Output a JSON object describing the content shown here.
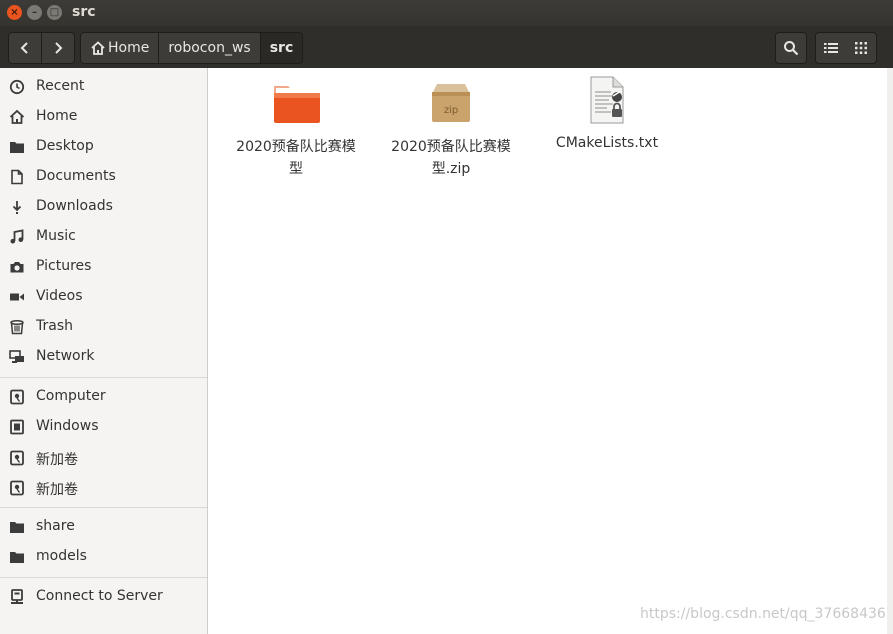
{
  "window": {
    "title": "src"
  },
  "titlebar": {
    "close_glyph": "×",
    "min_glyph": "–",
    "max_glyph": "□"
  },
  "nav": {
    "back_icon": "chevron-left-icon",
    "forward_icon": "chevron-right-icon"
  },
  "breadcrumbs": [
    {
      "label": "Home",
      "icon": "home-icon"
    },
    {
      "label": "robocon_ws"
    },
    {
      "label": "src"
    }
  ],
  "toolbar": {
    "search_icon": "search-icon",
    "list_icon": "list-view-icon",
    "grid_icon": "grid-view-icon"
  },
  "sidebar": {
    "places": [
      {
        "label": "Recent",
        "icon": "clock-icon"
      },
      {
        "label": "Home",
        "icon": "home-icon"
      },
      {
        "label": "Desktop",
        "icon": "folder-icon"
      },
      {
        "label": "Documents",
        "icon": "document-icon"
      },
      {
        "label": "Downloads",
        "icon": "download-icon"
      },
      {
        "label": "Music",
        "icon": "music-icon"
      },
      {
        "label": "Pictures",
        "icon": "camera-icon"
      },
      {
        "label": "Videos",
        "icon": "video-icon"
      },
      {
        "label": "Trash",
        "icon": "trash-icon"
      },
      {
        "label": "Network",
        "icon": "network-icon"
      }
    ],
    "devices": [
      {
        "label": "Computer",
        "icon": "drive-icon"
      },
      {
        "label": "Windows",
        "icon": "chip-icon"
      },
      {
        "label": "新加卷",
        "icon": "drive-icon"
      },
      {
        "label": "新加卷",
        "icon": "drive-icon"
      }
    ],
    "bookmarks": [
      {
        "label": "share",
        "icon": "folder-icon"
      },
      {
        "label": "models",
        "icon": "folder-icon"
      }
    ],
    "other": [
      {
        "label": "Connect to Server",
        "icon": "server-icon"
      }
    ]
  },
  "files": [
    {
      "line1": "2020预备队比赛模",
      "line2": "型",
      "type": "folder",
      "color": "#e95420"
    },
    {
      "line1": "2020预备队比赛模",
      "line2": "型.zip",
      "type": "zip",
      "icon_text": "zip"
    },
    {
      "line1": "CMakeLists.txt",
      "line2": "",
      "type": "text"
    }
  ],
  "watermark": "https://blog.csdn.net/qq_37668436"
}
